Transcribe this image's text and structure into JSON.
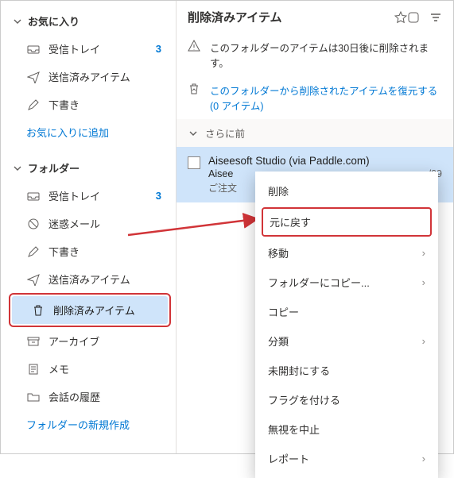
{
  "sidebar": {
    "favorites": {
      "header": "お気に入り",
      "items": [
        {
          "icon": "inbox-icon",
          "label": "受信トレイ",
          "badge": "3"
        },
        {
          "icon": "send-icon",
          "label": "送信済みアイテム"
        },
        {
          "icon": "draft-icon",
          "label": "下書き"
        }
      ],
      "add_link": "お気に入りに追加"
    },
    "folders": {
      "header": "フォルダー",
      "items": [
        {
          "icon": "inbox-icon",
          "label": "受信トレイ",
          "badge": "3"
        },
        {
          "icon": "junk-icon",
          "label": "迷惑メール"
        },
        {
          "icon": "draft-icon",
          "label": "下書き"
        },
        {
          "icon": "send-icon",
          "label": "送信済みアイテム"
        },
        {
          "icon": "trash-icon",
          "label": "削除済みアイテム",
          "selected": true
        },
        {
          "icon": "archive-icon",
          "label": "アーカイブ"
        },
        {
          "icon": "note-icon",
          "label": "メモ"
        },
        {
          "icon": "folder-icon",
          "label": "会話の履歴"
        }
      ],
      "new_link": "フォルダーの新規作成"
    }
  },
  "content": {
    "title": "削除済みアイテム",
    "banner_retention": "このフォルダーのアイテムは30日後に削除されます。",
    "banner_restore": "このフォルダーから削除されたアイテムを復元する (0 アイテム)",
    "group_label": "さらに前",
    "mail": {
      "from": "Aiseesoft Studio (via Paddle.com)",
      "subject_left": "Aisee",
      "subject_right": "/09",
      "preview": "ご注文"
    }
  },
  "context_menu": {
    "items": [
      {
        "label": "削除"
      },
      {
        "label": "元に戻す",
        "highlight": true
      },
      {
        "label": "移動",
        "submenu": true
      },
      {
        "label": "フォルダーにコピー...",
        "submenu": true
      },
      {
        "label": "コピー"
      },
      {
        "label": "分類",
        "submenu": true
      },
      {
        "label": "未開封にする"
      },
      {
        "label": "フラグを付ける"
      },
      {
        "label": "無視を中止"
      },
      {
        "label": "レポート",
        "submenu": true
      }
    ]
  }
}
